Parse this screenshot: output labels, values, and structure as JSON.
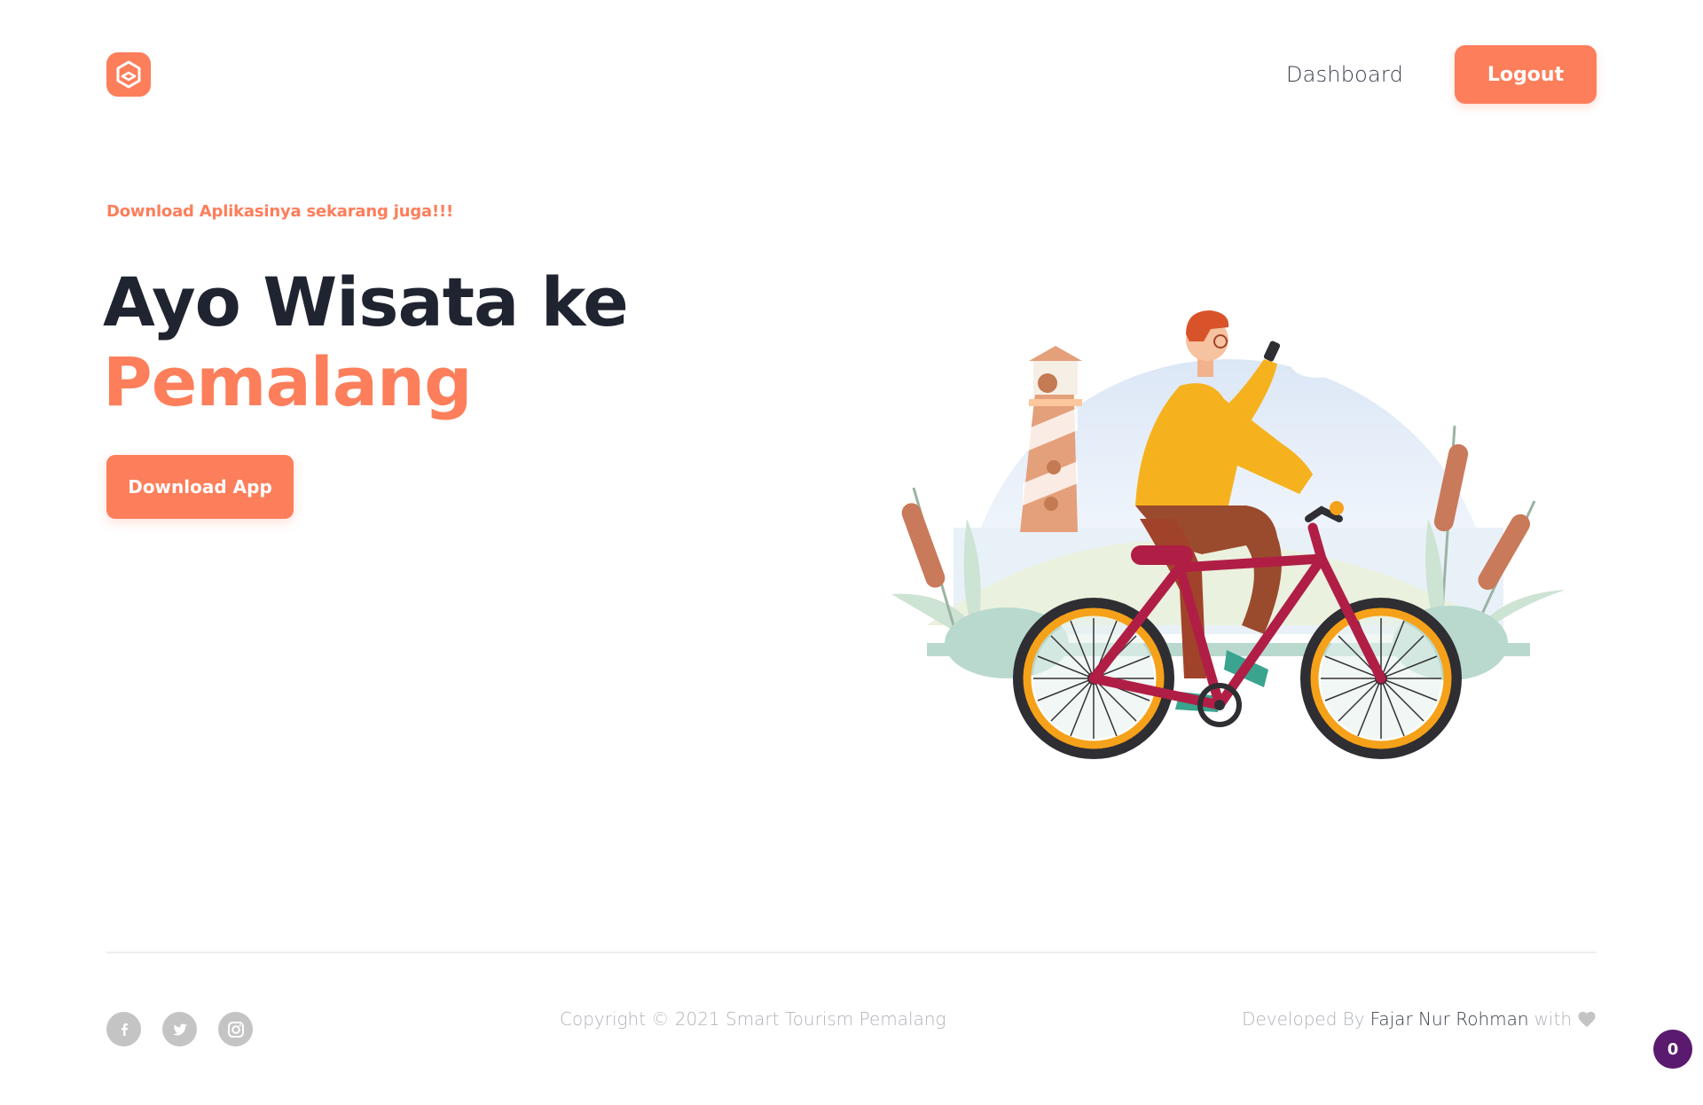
{
  "header": {
    "logo_icon": "hexagon-logo-icon",
    "nav": {
      "dashboard_label": "Dashboard"
    },
    "logout_label": "Logout"
  },
  "hero": {
    "tagline": "Download Aplikasinya sekarang juga!!!",
    "title_line1": "Ayo Wisata ke",
    "title_line2": "Pemalang",
    "download_label": "Download App"
  },
  "footer": {
    "socials": [
      "facebook-icon",
      "twitter-icon",
      "instagram-icon"
    ],
    "copyright": "Copyright © 2021 Smart Tourism Pemalang",
    "credit_prefix": "Developed By",
    "credit_author": "Fajar Nur Rohman",
    "credit_suffix": "with"
  },
  "badge": {
    "count": "0"
  },
  "colors": {
    "accent": "#fd7e5b",
    "dark_text": "#1f2430",
    "muted_text": "#b0b3b9",
    "badge_bg": "#5a1a6e"
  }
}
